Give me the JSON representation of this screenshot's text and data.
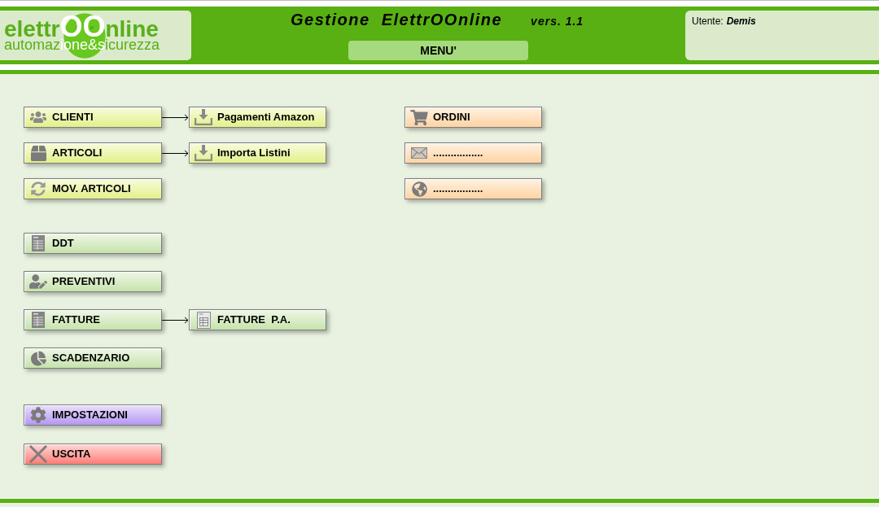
{
  "header": {
    "logo": {
      "brand": [
        {
          "text": "elettr",
          "highlight": false
        },
        {
          "text": "OO",
          "highlight": true
        },
        {
          "text": "nline",
          "highlight": false
        }
      ],
      "tagline": [
        {
          "text": "automaz",
          "highlight": false
        },
        {
          "text": "ione&s",
          "highlight": true
        },
        {
          "text": "icurezza",
          "highlight": false
        }
      ]
    },
    "title": "Gestione  ElettrOOnline",
    "version": "vers. 1.1",
    "menu_button": "MENU'",
    "user": {
      "label": "Utente:",
      "name": "Demis"
    }
  },
  "left_menu": [
    [
      {
        "label": "CLIENTI",
        "color": "#e4f08a",
        "children": [
          {
            "label": "Pagamenti Amazon",
            "color": "#e4f08a"
          }
        ]
      },
      {
        "label": "ARTICOLI",
        "color": "#e4f08a",
        "children": [
          {
            "label": "Importa Listini",
            "color": "#e4f08a"
          }
        ]
      },
      {
        "label": "MOV. ARTICOLI",
        "color": "#e4f08a"
      }
    ],
    [
      {
        "label": "DDT",
        "color": "#c6e3ac"
      },
      {
        "label": "PREVENTIVI",
        "color": "#c6e3ac"
      },
      {
        "label": "FATTURE",
        "color": "#c6e3ac",
        "children": [
          {
            "label": "FATTURE  P.A.",
            "color": "#c6e3ac"
          }
        ]
      },
      {
        "label": "SCADENZARIO",
        "color": "#c6e3ac"
      }
    ],
    [
      {
        "label": "IMPOSTAZIONI",
        "color": "#b496f2"
      },
      {
        "label": "USCITA",
        "color": "#ff7c76"
      }
    ]
  ],
  "right_menu": [
    {
      "label": "ORDINI",
      "color": "#ffd3a2"
    },
    {
      "label": ".................",
      "color": "#ffd3a2"
    },
    {
      "label": ".................",
      "color": "#ffd3a2"
    }
  ]
}
